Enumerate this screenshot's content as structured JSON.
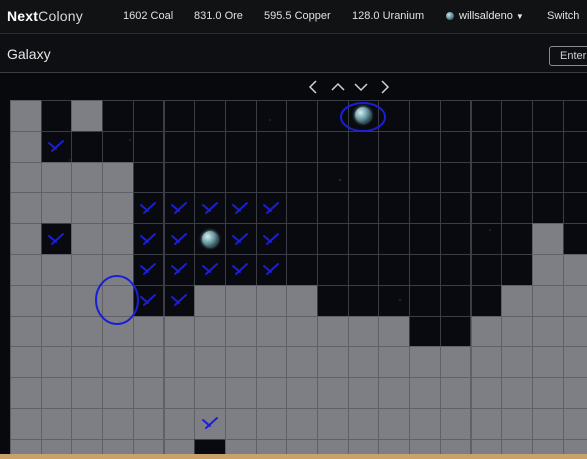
{
  "header": {
    "brand_bold": "Next",
    "brand_light": "Colony",
    "resources": [
      {
        "label": "1602 Coal"
      },
      {
        "label": "831.0 Ore"
      },
      {
        "label": "595.5 Copper"
      },
      {
        "label": "128.0 Uranium"
      }
    ],
    "user": "willsaldeno",
    "switch_label": "Switch"
  },
  "subbar": {
    "title": "Galaxy",
    "enter_label": "Enter"
  },
  "nav": [
    "left-arrow",
    "up-arrow",
    "down-arrow",
    "right-arrow"
  ],
  "colors": {
    "fog": "#7d7f84",
    "space": "#0a0b0f",
    "annotation": "#1a1fd6",
    "accent_bottom": "#c8a26b"
  },
  "galaxy": {
    "cols": 19,
    "rows": 12,
    "fog_rows": [
      "SSSSSSSSSSSSSSSSSSS",
      "FSSSSSSSSSSSSSSSSSS",
      "FFFFSSSSSSSSSSSSSSS",
      "FFFFSSSSSSSSSSSSSSS",
      "FSFFSSSSSSSSSSSSSFS",
      "FFFFSSSSSSSSSSSSSFF",
      "FFFFSSFFFFSSSSSSFFF",
      "FFFFFFFFFFFFFSSFFFF",
      "FFFFFFFFFFFFFFFFFFF",
      "FFFFFFFFFFFFFFFFFFF",
      "FFFFFFFFFFFFFFFFFFF",
      "FFFFFFSFFFFFFFFFFFF"
    ],
    "dark_top_row_fog": [
      0,
      2
    ],
    "planets": [
      {
        "col": 11,
        "row": 0,
        "icon": "planet-icon"
      },
      {
        "col": 6,
        "row": 4,
        "icon": "planet-icon"
      }
    ],
    "checked_tiles": [
      [
        1,
        1
      ],
      [
        4,
        3
      ],
      [
        5,
        3
      ],
      [
        6,
        3
      ],
      [
        7,
        3
      ],
      [
        8,
        3
      ],
      [
        1,
        4
      ],
      [
        4,
        4
      ],
      [
        5,
        4
      ],
      [
        7,
        4
      ],
      [
        8,
        4
      ],
      [
        4,
        5
      ],
      [
        5,
        5
      ],
      [
        6,
        5
      ],
      [
        7,
        5
      ],
      [
        8,
        5
      ],
      [
        4,
        6
      ],
      [
        5,
        6
      ],
      [
        6,
        10
      ]
    ],
    "circled": [
      {
        "col": 11,
        "row": 0
      },
      {
        "col": 3,
        "row": 6
      }
    ]
  }
}
